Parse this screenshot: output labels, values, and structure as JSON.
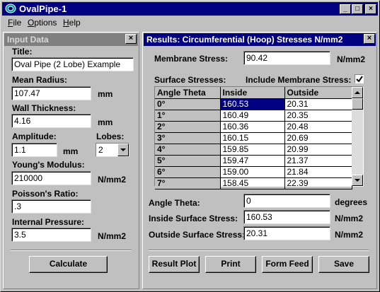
{
  "app": {
    "title": "OvalPipe-1"
  },
  "titlebar_buttons": {
    "minimize": "_",
    "maximize": "□",
    "close": "×"
  },
  "menu": [
    {
      "underline": "F",
      "rest": "ile"
    },
    {
      "underline": "O",
      "rest": "ptions"
    },
    {
      "underline": "H",
      "rest": "elp"
    }
  ],
  "input_panel": {
    "title": "Input Data",
    "close": "×",
    "title_label": "Title:",
    "title_value": "Oval Pipe (2 Lobe) Example",
    "mean_radius_label": "Mean Radius:",
    "mean_radius_value": "107.47",
    "mean_radius_unit": "mm",
    "wall_thickness_label": "Wall Thickness:",
    "wall_thickness_value": "4.16",
    "wall_thickness_unit": "mm",
    "amplitude_label": "Amplitude:",
    "amplitude_value": "1.1",
    "amplitude_unit": "mm",
    "lobes_label": "Lobes:",
    "lobes_value": "2",
    "youngs_label": "Young's Modulus:",
    "youngs_value": "210000",
    "youngs_unit": "N/mm2",
    "poisson_label": "Poisson's Ratio:",
    "poisson_value": ".3",
    "pressure_label": "Internal Pressure:",
    "pressure_value": "3.5",
    "pressure_unit": "N/mm2",
    "calculate": "Calculate"
  },
  "results_panel": {
    "title": "Results: Circumferential (Hoop) Stresses N/mm2",
    "close": "×",
    "membrane_label": "Membrane Stress:",
    "membrane_value": "90.42",
    "membrane_unit": "N/mm2",
    "surface_label": "Surface Stresses:",
    "include_label": "Include Membrane Stress:",
    "include_checked": true,
    "table": {
      "headers": [
        "Angle Theta",
        "Inside",
        "Outside"
      ],
      "rows": [
        [
          "0°",
          "160.53",
          "20.31"
        ],
        [
          "1°",
          "160.49",
          "20.35"
        ],
        [
          "2°",
          "160.36",
          "20.48"
        ],
        [
          "3°",
          "160.15",
          "20.69"
        ],
        [
          "4°",
          "159.85",
          "20.99"
        ],
        [
          "5°",
          "159.47",
          "21.37"
        ],
        [
          "6°",
          "159.00",
          "21.84"
        ],
        [
          "7°",
          "158.45",
          "22.39"
        ]
      ],
      "selected_row": 0
    },
    "angle_label": "Angle Theta:",
    "angle_value": "0",
    "angle_unit": "degrees",
    "inside_label": "Inside Surface Stress:",
    "inside_value": "160.53",
    "inside_unit": "N/mm2",
    "outside_label": "Outside Surface Stress:",
    "outside_value": "20.31",
    "outside_unit": "N/mm2",
    "buttons": {
      "result_plot": "Result Plot",
      "print": "Print",
      "form_feed": "Form Feed",
      "save": "Save"
    }
  },
  "colors": {
    "titlebar_active": "#000080",
    "titlebar_inactive": "#808080",
    "face": "#c0c0c0",
    "selection": "#000080"
  },
  "icons": [
    "app-icon",
    "minimize-icon",
    "maximize-icon",
    "close-icon",
    "chevron-down-icon",
    "checkmark-icon",
    "scroll-up-icon",
    "scroll-down-icon"
  ]
}
